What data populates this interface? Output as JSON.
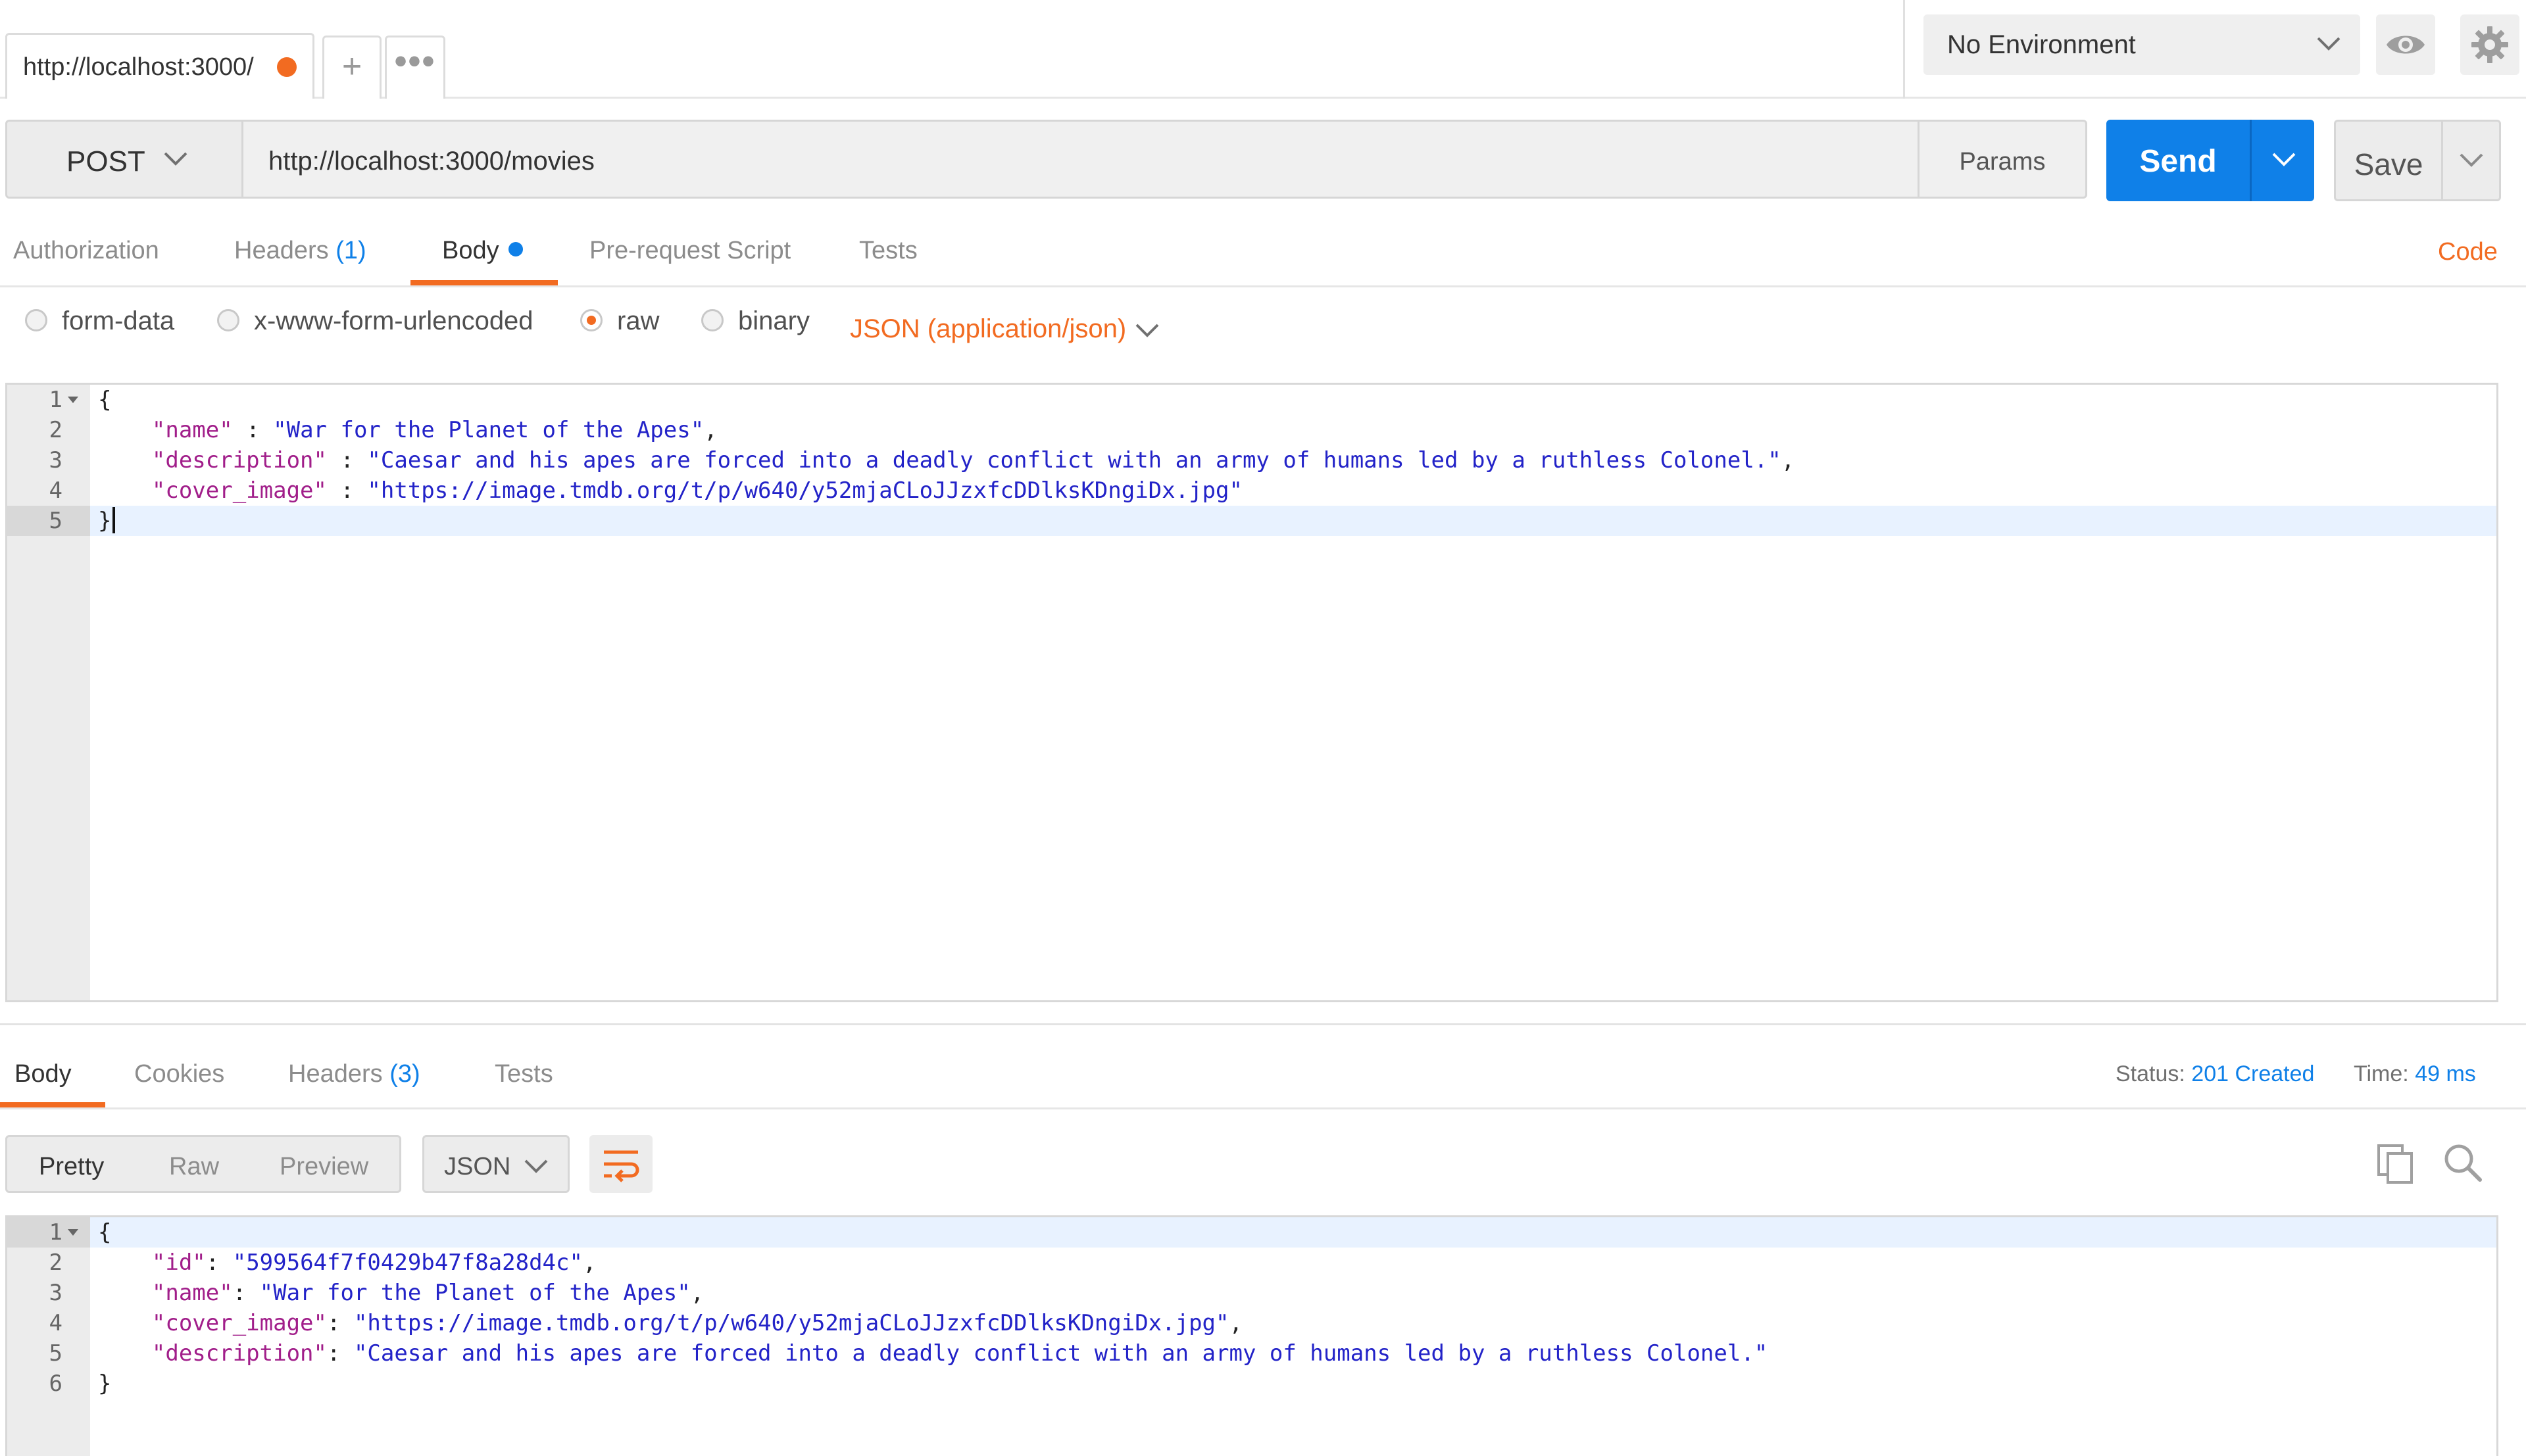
{
  "tabs": {
    "active_label": "http://localhost:3000/",
    "add_label": "+",
    "more_label": "•••"
  },
  "environment": {
    "selected": "No Environment"
  },
  "request": {
    "method": "POST",
    "url": "http://localhost:3000/movies",
    "params_label": "Params",
    "send_label": "Send",
    "save_label": "Save",
    "tabs": [
      {
        "label": "Authorization",
        "count": ""
      },
      {
        "label": "Headers",
        "count": "(1)"
      },
      {
        "label": "Body",
        "count": ""
      },
      {
        "label": "Pre-request Script",
        "count": ""
      },
      {
        "label": "Tests",
        "count": ""
      }
    ],
    "code_label": "Code",
    "body_modes": [
      "form-data",
      "x-www-form-urlencoded",
      "raw",
      "binary"
    ],
    "selected_mode": "raw",
    "content_type": "JSON (application/json)",
    "line_numbers": [
      "1",
      "2",
      "3",
      "4",
      "5"
    ],
    "body_lines": [
      {
        "key": "",
        "sep": "",
        "value": "",
        "brace": "{"
      },
      {
        "key": "\"name\"",
        "sep": " : ",
        "value": "\"War for the Planet of the Apes\"",
        "tail": ","
      },
      {
        "key": "\"description\"",
        "sep": " : ",
        "value": "\"Caesar and his apes are forced into a deadly conflict with an army of humans led by a ruthless Colonel.\"",
        "tail": ","
      },
      {
        "key": "\"cover_image\"",
        "sep": " : ",
        "value": "\"https://image.tmdb.org/t/p/w640/y52mjaCLoJJzxfcDDlksKDngiDx.jpg\"",
        "tail": ""
      },
      {
        "key": "",
        "sep": "",
        "value": "",
        "brace": "}"
      }
    ]
  },
  "response": {
    "tabs": [
      {
        "label": "Body",
        "count": ""
      },
      {
        "label": "Cookies",
        "count": ""
      },
      {
        "label": "Headers",
        "count": "(3)"
      },
      {
        "label": "Tests",
        "count": ""
      }
    ],
    "status_label": "Status:",
    "status_value": "201 Created",
    "time_label": "Time:",
    "time_value": "49 ms",
    "views": [
      "Pretty",
      "Raw",
      "Preview"
    ],
    "format": "JSON",
    "line_numbers": [
      "1",
      "2",
      "3",
      "4",
      "5",
      "6"
    ],
    "body_lines": [
      {
        "brace": "{"
      },
      {
        "key": "\"id\"",
        "sep": ": ",
        "value": "\"599564f7f0429b47f8a28d4c\"",
        "tail": ","
      },
      {
        "key": "\"name\"",
        "sep": ": ",
        "value": "\"War for the Planet of the Apes\"",
        "tail": ","
      },
      {
        "key": "\"cover_image\"",
        "sep": ": ",
        "value": "\"https://image.tmdb.org/t/p/w640/y52mjaCLoJJzxfcDDlksKDngiDx.jpg\"",
        "tail": ","
      },
      {
        "key": "\"description\"",
        "sep": ": ",
        "value": "\"Caesar and his apes are forced into a deadly conflict with an army of humans led by a ruthless Colonel.\"",
        "tail": ""
      },
      {
        "brace": "}"
      }
    ]
  },
  "colors": {
    "accent_orange": "#f26b21",
    "accent_blue": "#0f80e8",
    "json_key": "#a11e8a",
    "json_string": "#2323c8"
  },
  "icons": {
    "unsaved": "unsaved-dot-icon",
    "environment": "chevron-down-icon",
    "eye": "eye-icon",
    "settings": "gear-icon",
    "wrap": "wrap-lines-icon",
    "copy": "copy-icon",
    "search": "search-icon"
  }
}
